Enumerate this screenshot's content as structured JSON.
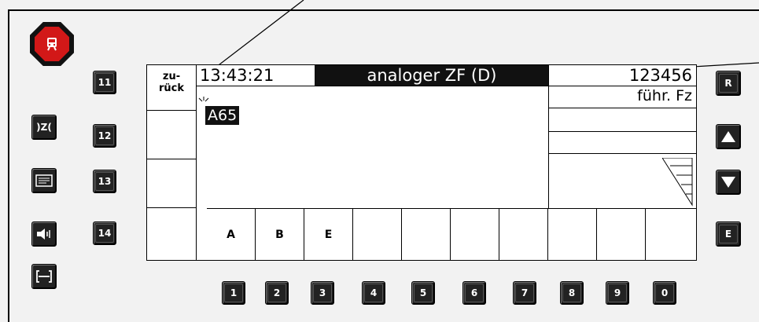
{
  "side_keys": {
    "number_keys": [
      "11",
      "12",
      "13",
      "14"
    ],
    "left_icons": [
      "train-icon",
      "coupling-icon",
      "screen-icon",
      "speaker-icon",
      "bracket-icon"
    ],
    "left_labels": [
      "",
      ")Z(",
      "",
      "",
      ""
    ],
    "right_keys": [
      "R",
      "up-arrow-icon",
      "down-arrow-icon",
      "E"
    ],
    "right_labels": [
      "R",
      "",
      "",
      "E"
    ]
  },
  "display": {
    "back_label_line1": "zu-",
    "back_label_line2": "rück",
    "clock": "13:43:21",
    "mode": "analoger ZF (D)",
    "train_number": "123456",
    "vehicle_label": "führ. Fz",
    "train_id": "A65"
  },
  "soft_keys": [
    "A",
    "B",
    "E",
    "",
    "",
    "",
    "",
    "",
    "",
    ""
  ],
  "digit_keys": [
    "1",
    "2",
    "3",
    "4",
    "5",
    "6",
    "7",
    "8",
    "9",
    "0"
  ],
  "colors": {
    "alarm_red": "#d21818",
    "key_black": "#222222",
    "screen_white": "#ffffff"
  }
}
